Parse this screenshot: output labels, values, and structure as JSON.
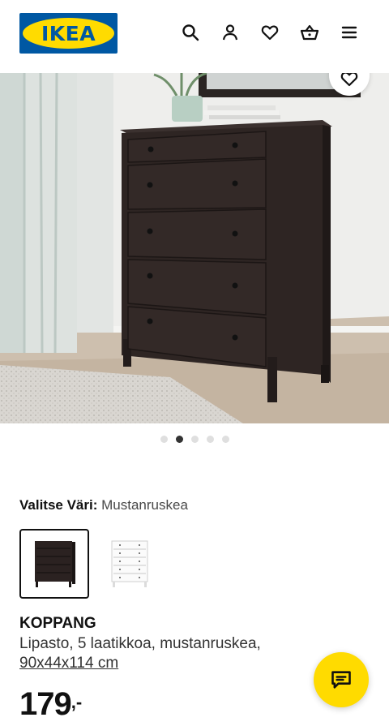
{
  "header": {
    "logo_text": "IKEA",
    "brand_blue": "#0058a3",
    "brand_yellow": "#ffdb00",
    "icons": [
      "search-icon",
      "user-icon",
      "heart-icon",
      "basket-icon",
      "menu-icon"
    ]
  },
  "gallery": {
    "image": "KOPPANG chest of drawers, black-brown, in room",
    "dots": 5,
    "active_dot": 2
  },
  "color_select": {
    "label": "Valitse Väri:",
    "value": "Mustanruskea",
    "options": [
      "Mustanruskea",
      "Valkoinen"
    ],
    "selected": 0
  },
  "product": {
    "name": "KOPPANG",
    "description": "Lipasto, 5 laatikkoa, mustanruskea,",
    "dimensions": "90x44x114 cm",
    "price_main": "179",
    "price_suffix": ",-"
  },
  "chat": {
    "icon": "chat-icon"
  }
}
